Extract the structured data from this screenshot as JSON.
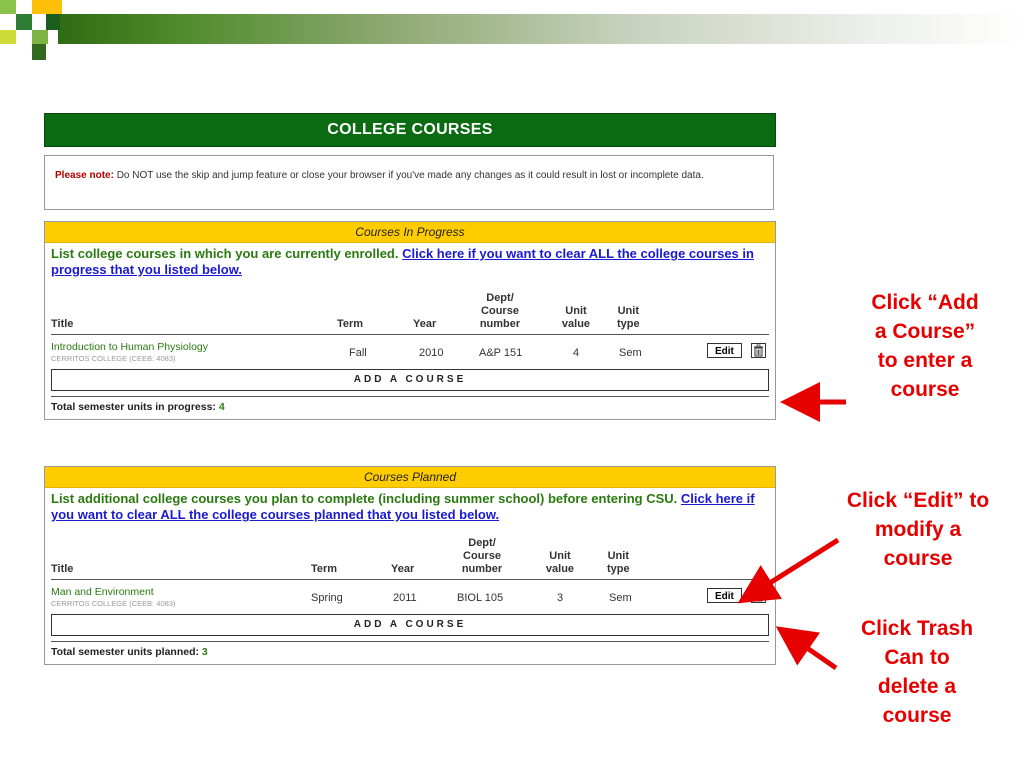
{
  "page": {
    "header_title": "COLLEGE COURSES",
    "note_label": "Please note:",
    "note_text": "Do NOT use the skip and jump feature or close your browser if you've made any changes as it could result in lost or incomplete data."
  },
  "columns": {
    "title": "Title",
    "term": "Term",
    "year": "Year",
    "dept_l1": "Dept/",
    "dept_l2": "Course",
    "dept_l3": "number",
    "unit_l1": "Unit",
    "unit_l2": "value",
    "type_l1": "Unit",
    "type_l2": "type"
  },
  "in_progress": {
    "header": "Courses In Progress",
    "intro": "List college courses in which you are currently enrolled.",
    "clear_link": "Click here if you want to clear ALL the college courses in progress that you listed below.",
    "course": {
      "title": "Introduction to Human Physiology",
      "school": "CERRITOS COLLEGE (CEEB: 4083)",
      "term": "Fall",
      "year": "2010",
      "dept": "A&P 151",
      "units": "4",
      "type": "Sem"
    },
    "edit_label": "Edit",
    "add_label": "ADD A COURSE",
    "total_label": "Total semester units in progress:",
    "total_value": "4"
  },
  "planned": {
    "header": "Courses Planned",
    "intro": "List additional college courses you plan to complete (including summer school) before entering CSU.",
    "clear_link": "Click here if you want to clear ALL the college courses planned that you listed below.",
    "course": {
      "title": "Man and Environment",
      "school": "CERRITOS COLLEGE (CEEB: 4083)",
      "term": "Spring",
      "year": "2011",
      "dept": "BIOL 105",
      "units": "3",
      "type": "Sem"
    },
    "edit_label": "Edit",
    "add_label": "ADD A COURSE",
    "total_label": "Total semester units planned:",
    "total_value": "3"
  },
  "callouts": {
    "add": [
      "Click “Add",
      "a Course”",
      "to enter a",
      "course"
    ],
    "edit": [
      "Click “Edit” to",
      "modify a",
      "course"
    ],
    "trash": [
      "Click Trash",
      "Can to",
      "delete a",
      "course"
    ]
  },
  "colors": {
    "header_green": "#0b6b12",
    "panel_yellow": "#ffcc00",
    "intro_green": "#2a7a10",
    "callout_red": "#e60000"
  }
}
